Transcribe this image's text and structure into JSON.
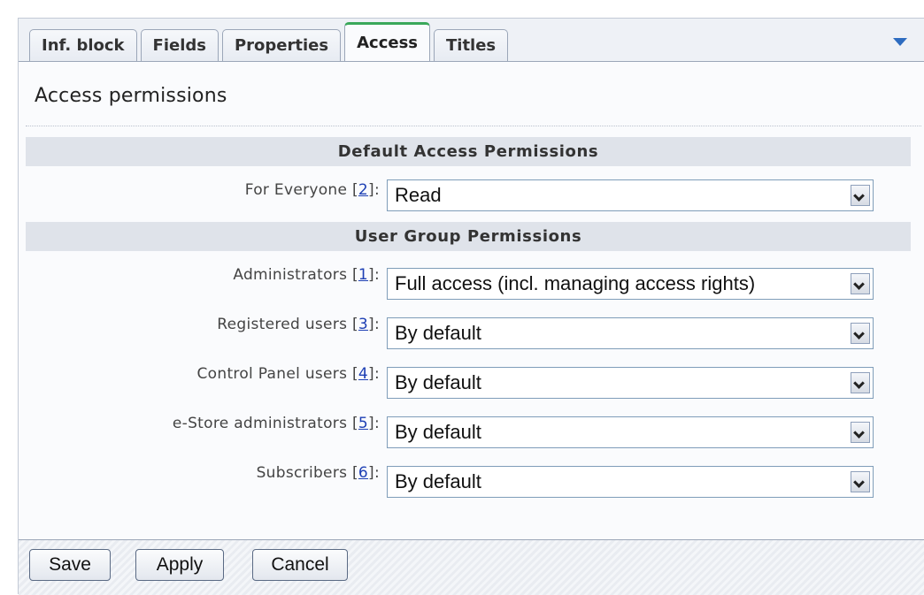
{
  "tabs": [
    {
      "label": "Inf. block"
    },
    {
      "label": "Fields"
    },
    {
      "label": "Properties"
    },
    {
      "label": "Access"
    },
    {
      "label": "Titles"
    }
  ],
  "active_tab": "Access",
  "panel": {
    "title": "Access permissions",
    "default_section": {
      "header": "Default Access Permissions",
      "row": {
        "label": "For Everyone",
        "ref": "2",
        "suffix": "]:",
        "prefix": " [",
        "value": "Read"
      }
    },
    "group_section": {
      "header": "User Group Permissions",
      "rows": [
        {
          "label": "Administrators",
          "ref": "1",
          "value": "Full access (incl. managing access rights)"
        },
        {
          "label": "Registered users",
          "ref": "3",
          "value": "By default"
        },
        {
          "label": "Control Panel users",
          "ref": "4",
          "value": "By default"
        },
        {
          "label": "e-Store administrators",
          "ref": "5",
          "value": "By default"
        },
        {
          "label": "Subscribers",
          "ref": "6",
          "value": "By default"
        }
      ]
    }
  },
  "footer": {
    "save_label": "Save",
    "apply_label": "Apply",
    "cancel_label": "Cancel"
  },
  "icons": {
    "menu": "chevron-down-icon",
    "select": "dropdown-arrow-icon"
  },
  "colors": {
    "active_tab_accent": "#3aa85a",
    "link": "#1d3fb4",
    "menu_arrow": "#2d6cc0"
  }
}
